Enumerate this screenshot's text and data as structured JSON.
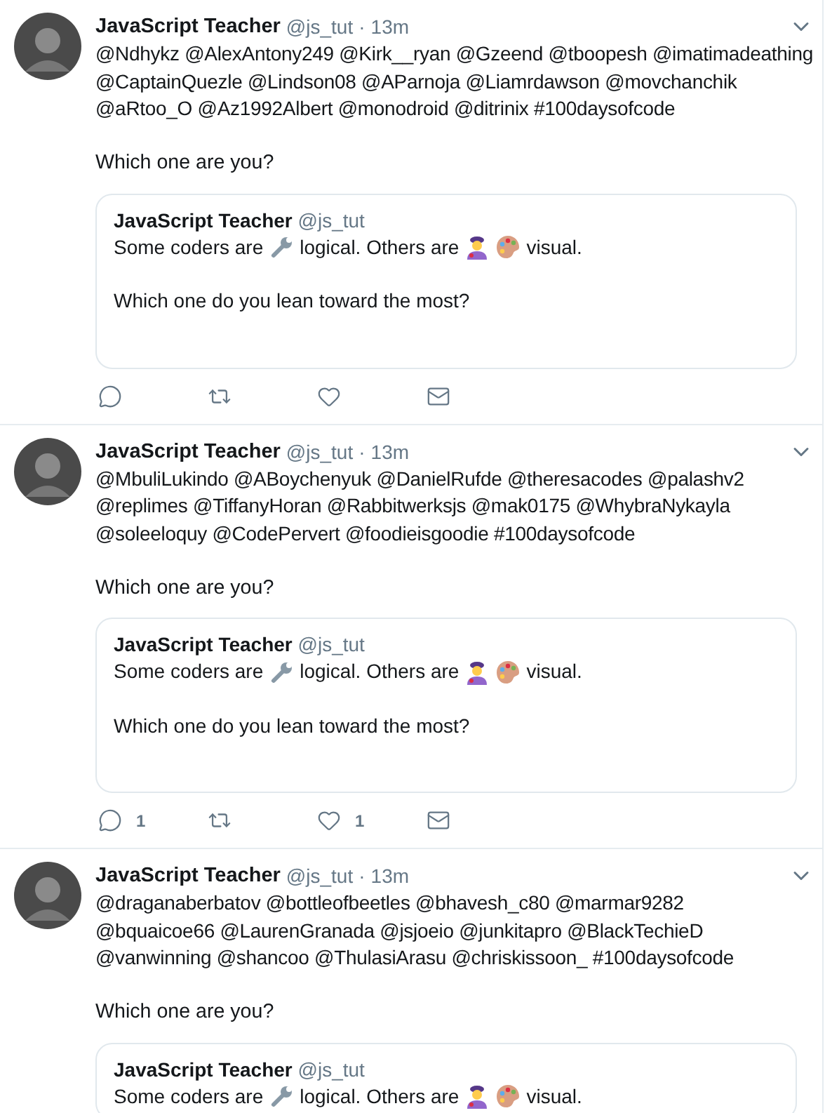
{
  "tweets": [
    {
      "author": "JavaScript Teacher",
      "handle": "@js_tut",
      "separator": "·",
      "time": "13m",
      "mentions": "@Ndhykz @AlexAntony249 @Kirk__ryan @Gzeend @tboopesh @imatimadeathing\n@CaptainQuezle @Lindson08 @AParnoja @Liamrdawson @movchanchik\n@aRtoo_O @Az1992Albert @monodroid @ditrinix #100daysofcode",
      "question": "Which one are you?",
      "quote": {
        "author": "JavaScript Teacher",
        "handle": "@js_tut",
        "segments": [
          "Some coders are",
          "logical. Others are",
          "visual."
        ],
        "question": "Which one do you lean toward the most?"
      },
      "actions": [
        {
          "kind": "reply"
        },
        {
          "kind": "retweet"
        },
        {
          "kind": "like"
        },
        {
          "kind": "message"
        }
      ]
    },
    {
      "author": "JavaScript Teacher",
      "handle": "@js_tut",
      "separator": "·",
      "time": "13m",
      "mentions": "@MbuliLukindo @ABoychenyuk @DanielRufde @theresacodes @palashv2\n@replimes @TiffanyHoran @Rabbitwerksjs @mak0175 @WhybraNykayla\n@soleeloquy @CodePervert @foodieisgoodie #100daysofcode",
      "question": "Which one are you?",
      "quote": {
        "author": "JavaScript Teacher",
        "handle": "@js_tut",
        "segments": [
          "Some coders are",
          "logical. Others are",
          "visual."
        ],
        "question": "Which one do you lean toward the most?"
      },
      "actions": [
        {
          "kind": "reply",
          "count": "1"
        },
        {
          "kind": "retweet"
        },
        {
          "kind": "like",
          "count": "1"
        },
        {
          "kind": "message"
        }
      ]
    },
    {
      "author": "JavaScript Teacher",
      "handle": "@js_tut",
      "separator": "·",
      "time": "13m",
      "mentions": "@draganaberbatov @bottleofbeetles @bhavesh_c80 @marmar9282\n@bquaicoe66 @LaurenGranada @jsjoeio @junkitapro @BlackTechieD\n@vanwinning @shancoo @ThulasiArasu @chriskissoon_ #100daysofcode",
      "question": "Which one are you?",
      "quote": {
        "author": "JavaScript Teacher",
        "handle": "@js_tut",
        "segments": [
          "Some coders are",
          "logical. Others are",
          "visual."
        ]
      }
    }
  ]
}
